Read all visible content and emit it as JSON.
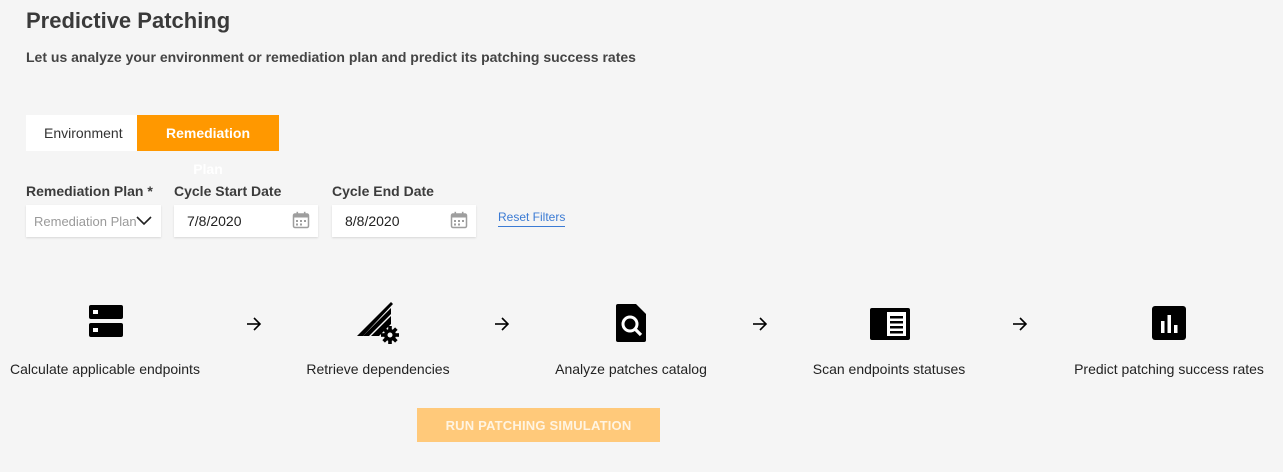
{
  "page": {
    "title": "Predictive Patching",
    "subtitle": "Let us analyze your environment or remediation plan and predict its patching success rates"
  },
  "tabs": [
    {
      "label": "Environment",
      "active": false
    },
    {
      "label": "Remediation Plan",
      "active": true
    }
  ],
  "filters": {
    "remediation_plan": {
      "label": "Remediation Plan *",
      "placeholder": "Remediation Plan"
    },
    "cycle_start": {
      "label": "Cycle Start Date",
      "value": "7/8/2020"
    },
    "cycle_end": {
      "label": "Cycle End Date",
      "value": "8/8/2020"
    },
    "reset_label": "Reset Filters"
  },
  "steps": [
    {
      "label": "Calculate applicable endpoints",
      "icon": "server-icon"
    },
    {
      "label": "Retrieve dependencies",
      "icon": "dependencies-gear-icon"
    },
    {
      "label": "Analyze patches catalog",
      "icon": "document-search-icon"
    },
    {
      "label": "Scan endpoints statuses",
      "icon": "scan-panel-icon"
    },
    {
      "label": "Predict patching success rates",
      "icon": "bar-chart-icon"
    }
  ],
  "run_button": {
    "label": "RUN PATCHING SIMULATION",
    "enabled": false
  },
  "colors": {
    "accent": "#ff9800",
    "accent_disabled": "#ffc97a",
    "link": "#3b7bd4",
    "background": "#f5f5f5"
  }
}
